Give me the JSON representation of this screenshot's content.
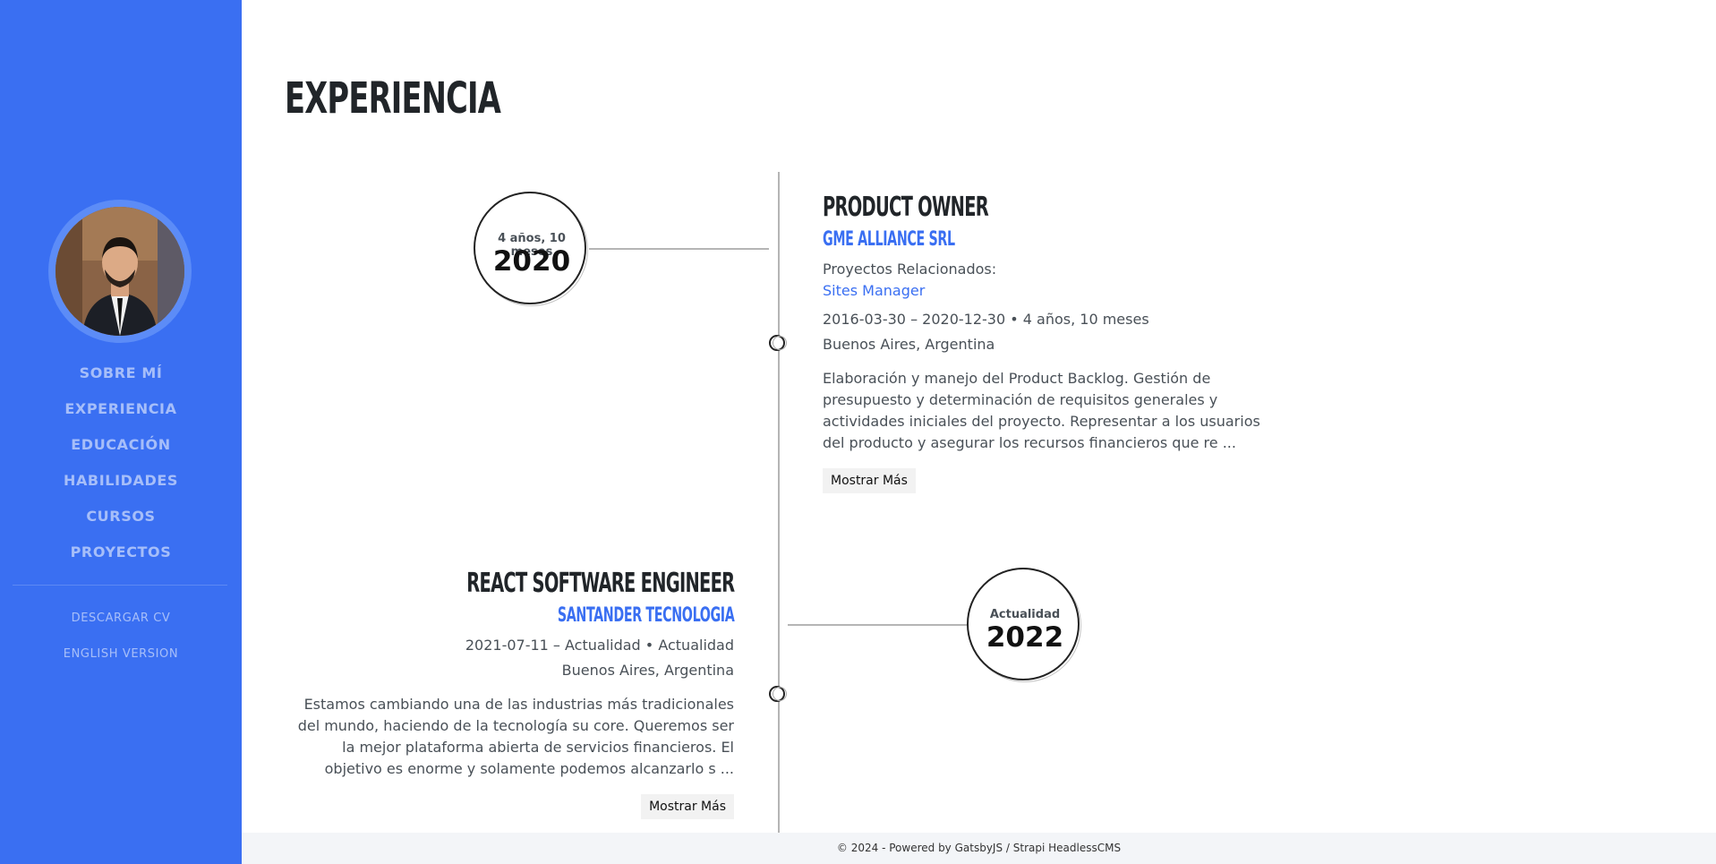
{
  "sidebar": {
    "nav": [
      {
        "label": "SOBRE MÍ"
      },
      {
        "label": "EXPERIENCIA"
      },
      {
        "label": "EDUCACIÓN"
      },
      {
        "label": "HABILIDADES"
      },
      {
        "label": "CURSOS"
      },
      {
        "label": "PROYECTOS"
      }
    ],
    "download_cv": "DESCARGAR CV",
    "english_version": "ENGLISH VERSION"
  },
  "main": {
    "title": "EXPERIENCIA",
    "jobs": [
      {
        "duration_badge": "4 años, 10 meses",
        "year": "2020",
        "role": "PRODUCT OWNER",
        "company": "GME ALLIANCE SRL",
        "related_label": "Proyectos Relacionados:",
        "related_project": "Sites Manager",
        "dates": "2016-03-30 – 2020-12-30 • 4 años, 10 meses",
        "location": "Buenos Aires, Argentina",
        "description": "Elaboración y manejo del Product Backlog. Gestión de presupuesto y determinación de requisitos generales y actividades iniciales del proyecto. Representar a los usuarios del producto y asegurar los recursos financieros que re ...",
        "button": "Mostrar Más"
      },
      {
        "duration_badge": "Actualidad",
        "year": "2022",
        "role": "REACT SOFTWARE ENGINEER",
        "company": "SANTANDER TECNOLOGIA",
        "dates": "2021-07-11 – Actualidad • Actualidad",
        "location": "Buenos Aires, Argentina",
        "description": "Estamos cambiando una de las industrias más tradicionales del mundo, haciendo de la tecnología su core. Queremos ser la mejor plataforma abierta de servicios financieros. El objetivo es enorme y solamente podemos alcanzarlo s ...",
        "button": "Mostrar Más"
      }
    ]
  },
  "footer": {
    "text": "© 2024 - Powered by GatsbyJS / Strapi HeadlessCMS"
  },
  "colors": {
    "accent": "#3a6ff2",
    "footer_bg": "#f3f5f8"
  }
}
